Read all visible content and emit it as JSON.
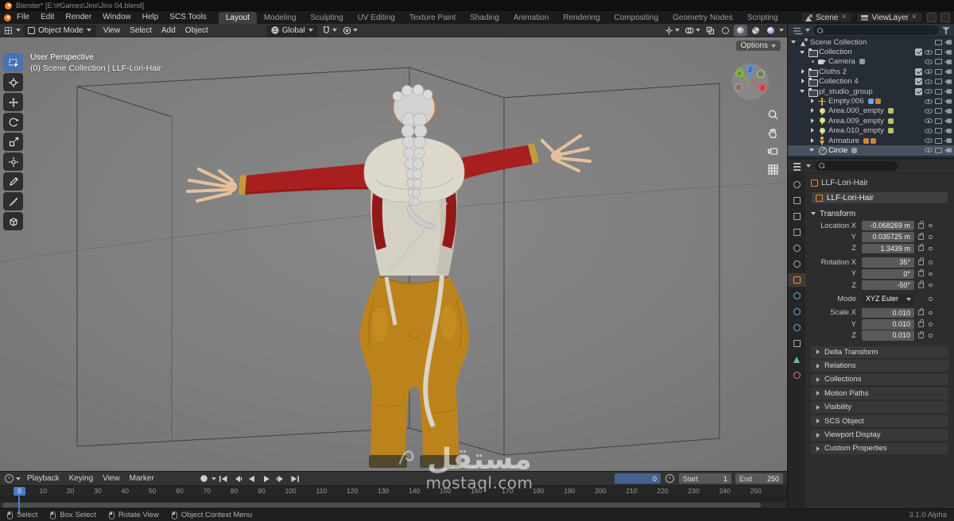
{
  "window": {
    "title": "Blender*  [E:\\#Games\\Jinx\\Jinx 04.blend]"
  },
  "topbar": {
    "menus": [
      "File",
      "Edit",
      "Render",
      "Window",
      "Help",
      "SCS Tools"
    ],
    "tabs": [
      "Layout",
      "Modeling",
      "Sculpting",
      "UV Editing",
      "Texture Paint",
      "Shading",
      "Animation",
      "Rendering",
      "Compositing",
      "Geometry Nodes",
      "Scripting"
    ],
    "active_tab": "Layout",
    "scene_label": "Scene",
    "view_layer_label": "ViewLayer"
  },
  "viewport_header": {
    "mode": "Object Mode",
    "menus": [
      "View",
      "Select",
      "Add",
      "Object"
    ],
    "orientation": "Global",
    "options_label": "Options"
  },
  "viewport": {
    "overlay_line1": "User Perspective",
    "overlay_line2": "(0) Scene Collection | LLF-Lori-Hair",
    "gizmo_axes": [
      "X",
      "Y",
      "Z"
    ]
  },
  "outliner": {
    "items": [
      {
        "label": "Scene Collection"
      },
      {
        "label": "Collection"
      },
      {
        "label": "Camera"
      },
      {
        "label": "Cloths 2"
      },
      {
        "label": "Collection 4"
      },
      {
        "label": "pl_studio_group"
      },
      {
        "label": "Empty.006"
      },
      {
        "label": "Area.000_empty"
      },
      {
        "label": "Area.009_empty"
      },
      {
        "label": "Area.010_empty"
      },
      {
        "label": "Armature"
      },
      {
        "label": "Circle"
      }
    ]
  },
  "properties": {
    "breadcrumb": "LLF-Lori-Hair",
    "object_name": "LLF-Lori-Hair",
    "transform_title": "Transform",
    "transform_rows": [
      {
        "label": "Location X",
        "value": "-0.068269 m"
      },
      {
        "label": "Y",
        "value": "0.035725 m"
      },
      {
        "label": "Z",
        "value": "1.3439 m"
      },
      {
        "label": "Rotation X",
        "value": "35°"
      },
      {
        "label": "Y",
        "value": "0°"
      },
      {
        "label": "Z",
        "value": "-50°"
      },
      {
        "label": "Mode",
        "value": "XYZ Euler"
      },
      {
        "label": "Scale X",
        "value": "0.010"
      },
      {
        "label": "Y",
        "value": "0.010"
      },
      {
        "label": "Z",
        "value": "0.010"
      }
    ],
    "sections": [
      "Delta Transform",
      "Relations",
      "Collections",
      "Motion Paths",
      "Visibility",
      "SCS Object",
      "Viewport Display",
      "Custom Properties"
    ]
  },
  "timeline": {
    "menus": [
      "Playback",
      "Keying",
      "View",
      "Marker"
    ],
    "current_frame": "0",
    "playhead_frame": "0",
    "start_label": "Start",
    "start_value": "1",
    "end_label": "End",
    "end_value": "250",
    "ticks": [
      "0",
      "10",
      "20",
      "30",
      "40",
      "50",
      "60",
      "70",
      "80",
      "90",
      "100",
      "110",
      "120",
      "130",
      "140",
      "150",
      "160",
      "170",
      "180",
      "190",
      "200",
      "210",
      "220",
      "230",
      "240",
      "250"
    ]
  },
  "statusbar": {
    "items": [
      "Select",
      "Box Select",
      "Rotate View",
      "Object Context Menu"
    ],
    "version": "3.1.0 Alpha"
  },
  "watermark": {
    "arabic": "مستقل",
    "latin": "mostaql.com"
  }
}
